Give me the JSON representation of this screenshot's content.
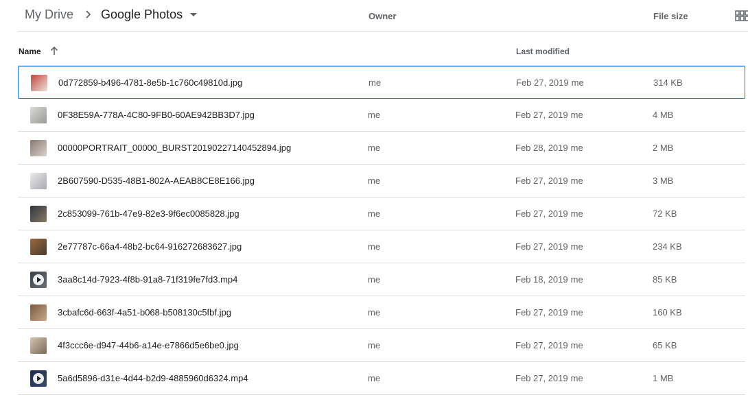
{
  "breadcrumb": {
    "root": "My Drive",
    "current": "Google Photos"
  },
  "columns": {
    "name": "Name",
    "owner": "Owner",
    "modified": "Last modified",
    "size": "File size"
  },
  "rows": [
    {
      "name": "0d772859-b496-4781-8e5b-1c760c49810d.jpg",
      "owner": "me",
      "modified": "Feb 27, 2019",
      "modified_by": "me",
      "size": "314 KB",
      "type": "image",
      "colors": [
        "#c4463a",
        "#e8e4e0"
      ]
    },
    {
      "name": "0F38E59A-778A-4C80-9FB0-60AE942BB3D7.jpg",
      "owner": "me",
      "modified": "Feb 27, 2019",
      "modified_by": "me",
      "size": "4 MB",
      "type": "image",
      "colors": [
        "#d9d9d6",
        "#9a9a96"
      ]
    },
    {
      "name": "00000PORTRAIT_00000_BURST20190227140452894.jpg",
      "owner": "me",
      "modified": "Feb 28, 2019",
      "modified_by": "me",
      "size": "2 MB",
      "type": "image",
      "colors": [
        "#8a7a70",
        "#d8d2cc"
      ]
    },
    {
      "name": "2B607590-D535-48B1-802A-AEAB8CE8E166.jpg",
      "owner": "me",
      "modified": "Feb 27, 2019",
      "modified_by": "me",
      "size": "3 MB",
      "type": "image",
      "colors": [
        "#ecebe8",
        "#a6a8b4"
      ]
    },
    {
      "name": "2c853099-761b-47e9-82e3-9f6ec0085828.jpg",
      "owner": "me",
      "modified": "Feb 27, 2019",
      "modified_by": "me",
      "size": "72 KB",
      "type": "image",
      "colors": [
        "#2f3440",
        "#8a7a66"
      ]
    },
    {
      "name": "2e77787c-66a4-48b2-bc64-916272683627.jpg",
      "owner": "me",
      "modified": "Feb 27, 2019",
      "modified_by": "me",
      "size": "234 KB",
      "type": "image",
      "colors": [
        "#9a6a3e",
        "#4a3a30"
      ]
    },
    {
      "name": "3aa8c14d-7923-4f8b-91a8-71f319fe7fd3.mp4",
      "owner": "me",
      "modified": "Feb 18, 2019",
      "modified_by": "me",
      "size": "85 KB",
      "type": "video",
      "colors": [
        "#3a4048",
        "#6a7078"
      ]
    },
    {
      "name": "3cbafc6d-663f-4a51-b068-b508130c5fbf.jpg",
      "owner": "me",
      "modified": "Feb 27, 2019",
      "modified_by": "me",
      "size": "160 KB",
      "type": "image",
      "colors": [
        "#7a5a40",
        "#c8a888"
      ]
    },
    {
      "name": "4f3ccc6e-d947-44b6-a14e-e7866d5e6be0.jpg",
      "owner": "me",
      "modified": "Feb 27, 2019",
      "modified_by": "me",
      "size": "65 KB",
      "type": "image",
      "colors": [
        "#d6c4b0",
        "#7a6a58"
      ]
    },
    {
      "name": "5a6d5896-d31e-4d44-b2d9-4885960d6324.mp4",
      "owner": "me",
      "modified": "Feb 27, 2019",
      "modified_by": "me",
      "size": "1 MB",
      "type": "video",
      "colors": [
        "#1e2a48",
        "#3a4a6a"
      ]
    }
  ],
  "selected_row": 0,
  "accent": "#1a73e8"
}
